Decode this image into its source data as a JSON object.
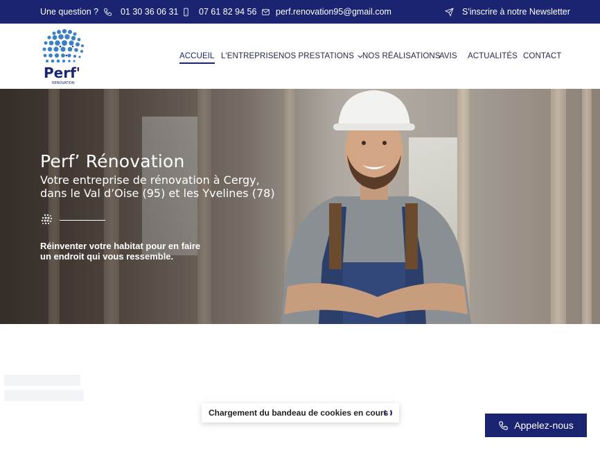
{
  "topbar": {
    "question_label": "Une question ?",
    "phone_1": "01 30 36 06 31",
    "phone_2": "07 61 82 94 56",
    "email": "perf.renovation95@gmail.com",
    "newsletter_label": "S'inscrire à notre Newsletter"
  },
  "logo": {
    "text": "Perf'",
    "subtext": "RENOVATION"
  },
  "nav": {
    "items": [
      {
        "label": "ACCUEIL",
        "active": true
      },
      {
        "label": "L'ENTREPRISE"
      },
      {
        "label": "NOS PRESTATIONS",
        "has_dropdown": true
      },
      {
        "label": "NOS RÉALISATIONS"
      },
      {
        "label": "AVIS"
      },
      {
        "label": "ACTUALITÉS"
      },
      {
        "label": "CONTACT"
      }
    ]
  },
  "hero": {
    "title": "Perf’ Rénovation",
    "subtitle": "Votre entreprise de rénovation à Cergy, dans le Val d’Oise (95) et les Yvelines (78)",
    "tagline": "Réinventer votre habitat pour en faire un endroit qui vous ressemble."
  },
  "cookie_banner": {
    "text": "Chargement du bandeau de cookies en cours"
  },
  "call_button": {
    "label": "Appelez-nous"
  },
  "colors": {
    "brand_navy": "#1a2470",
    "logo_blue": "#3b7fc4"
  },
  "icons": [
    "phone-icon",
    "mobile-icon",
    "mail-icon",
    "send-icon",
    "chevron-down-icon",
    "spinner-icon"
  ]
}
